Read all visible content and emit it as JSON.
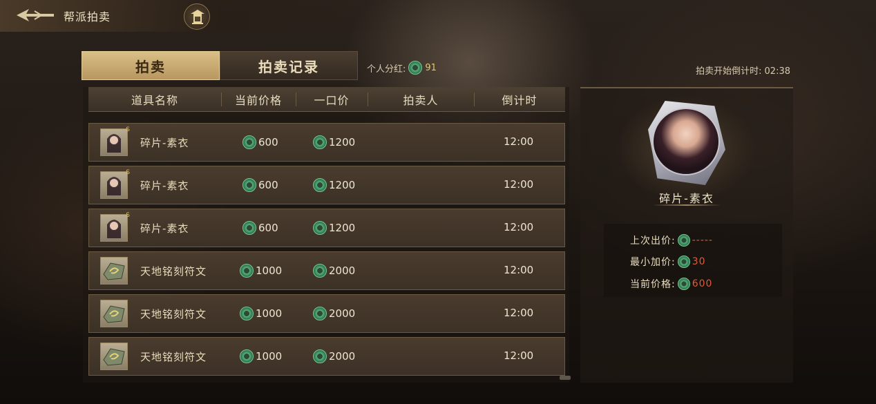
{
  "header": {
    "title": "帮派拍卖"
  },
  "tabs": [
    {
      "label": "拍卖",
      "active": true
    },
    {
      "label": "拍卖记录",
      "active": false
    }
  ],
  "dividend": {
    "label": "个人分红:",
    "value": "91"
  },
  "countdown": {
    "label": "拍卖开始倒计时:",
    "value": "02:38"
  },
  "table": {
    "columns": [
      "道具名称",
      "当前价格",
      "一口价",
      "拍卖人",
      "倒计时"
    ],
    "rows": [
      {
        "name": "碎片-素衣",
        "current_price": "600",
        "buyout": "1200",
        "seller": "",
        "time": "12:00",
        "icon": "portrait-fragment-icon"
      },
      {
        "name": "碎片-素衣",
        "current_price": "600",
        "buyout": "1200",
        "seller": "",
        "time": "12:00",
        "icon": "portrait-fragment-icon"
      },
      {
        "name": "碎片-素衣",
        "current_price": "600",
        "buyout": "1200",
        "seller": "",
        "time": "12:00",
        "icon": "portrait-fragment-icon"
      },
      {
        "name": "天地铭刻符文",
        "current_price": "1000",
        "buyout": "2000",
        "seller": "",
        "time": "12:00",
        "icon": "rune-stone-icon"
      },
      {
        "name": "天地铭刻符文",
        "current_price": "1000",
        "buyout": "2000",
        "seller": "",
        "time": "12:00",
        "icon": "rune-stone-icon"
      },
      {
        "name": "天地铭刻符文",
        "current_price": "1000",
        "buyout": "2000",
        "seller": "",
        "time": "12:00",
        "icon": "rune-stone-icon"
      }
    ]
  },
  "detail": {
    "name": "碎片-素衣",
    "last_bid_label": "上次出价:",
    "last_bid_value": "-----",
    "min_increment_label": "最小加价:",
    "min_increment_value": "30",
    "current_price_label": "当前价格:",
    "current_price_value": "600"
  },
  "colors": {
    "accent_gold": "#d9bf86",
    "currency_green": "#2f7e51",
    "value_red": "#e05a3a"
  }
}
